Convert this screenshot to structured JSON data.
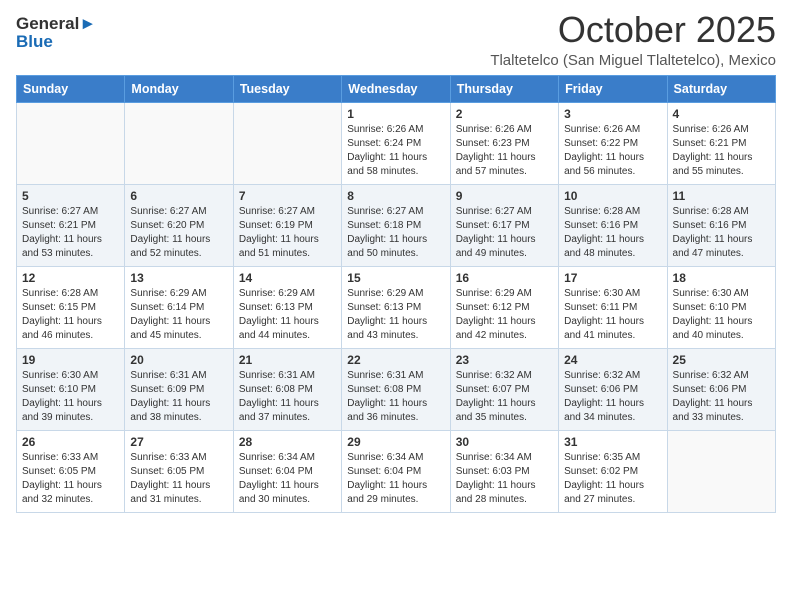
{
  "logo": {
    "line1": "General",
    "line2": "Blue"
  },
  "title": "October 2025",
  "location": "Tlaltetelco (San Miguel Tlaltetelco), Mexico",
  "days_of_week": [
    "Sunday",
    "Monday",
    "Tuesday",
    "Wednesday",
    "Thursday",
    "Friday",
    "Saturday"
  ],
  "weeks": [
    [
      {
        "day": "",
        "info": ""
      },
      {
        "day": "",
        "info": ""
      },
      {
        "day": "",
        "info": ""
      },
      {
        "day": "1",
        "info": "Sunrise: 6:26 AM\nSunset: 6:24 PM\nDaylight: 11 hours\nand 58 minutes."
      },
      {
        "day": "2",
        "info": "Sunrise: 6:26 AM\nSunset: 6:23 PM\nDaylight: 11 hours\nand 57 minutes."
      },
      {
        "day": "3",
        "info": "Sunrise: 6:26 AM\nSunset: 6:22 PM\nDaylight: 11 hours\nand 56 minutes."
      },
      {
        "day": "4",
        "info": "Sunrise: 6:26 AM\nSunset: 6:21 PM\nDaylight: 11 hours\nand 55 minutes."
      }
    ],
    [
      {
        "day": "5",
        "info": "Sunrise: 6:27 AM\nSunset: 6:21 PM\nDaylight: 11 hours\nand 53 minutes."
      },
      {
        "day": "6",
        "info": "Sunrise: 6:27 AM\nSunset: 6:20 PM\nDaylight: 11 hours\nand 52 minutes."
      },
      {
        "day": "7",
        "info": "Sunrise: 6:27 AM\nSunset: 6:19 PM\nDaylight: 11 hours\nand 51 minutes."
      },
      {
        "day": "8",
        "info": "Sunrise: 6:27 AM\nSunset: 6:18 PM\nDaylight: 11 hours\nand 50 minutes."
      },
      {
        "day": "9",
        "info": "Sunrise: 6:27 AM\nSunset: 6:17 PM\nDaylight: 11 hours\nand 49 minutes."
      },
      {
        "day": "10",
        "info": "Sunrise: 6:28 AM\nSunset: 6:16 PM\nDaylight: 11 hours\nand 48 minutes."
      },
      {
        "day": "11",
        "info": "Sunrise: 6:28 AM\nSunset: 6:16 PM\nDaylight: 11 hours\nand 47 minutes."
      }
    ],
    [
      {
        "day": "12",
        "info": "Sunrise: 6:28 AM\nSunset: 6:15 PM\nDaylight: 11 hours\nand 46 minutes."
      },
      {
        "day": "13",
        "info": "Sunrise: 6:29 AM\nSunset: 6:14 PM\nDaylight: 11 hours\nand 45 minutes."
      },
      {
        "day": "14",
        "info": "Sunrise: 6:29 AM\nSunset: 6:13 PM\nDaylight: 11 hours\nand 44 minutes."
      },
      {
        "day": "15",
        "info": "Sunrise: 6:29 AM\nSunset: 6:13 PM\nDaylight: 11 hours\nand 43 minutes."
      },
      {
        "day": "16",
        "info": "Sunrise: 6:29 AM\nSunset: 6:12 PM\nDaylight: 11 hours\nand 42 minutes."
      },
      {
        "day": "17",
        "info": "Sunrise: 6:30 AM\nSunset: 6:11 PM\nDaylight: 11 hours\nand 41 minutes."
      },
      {
        "day": "18",
        "info": "Sunrise: 6:30 AM\nSunset: 6:10 PM\nDaylight: 11 hours\nand 40 minutes."
      }
    ],
    [
      {
        "day": "19",
        "info": "Sunrise: 6:30 AM\nSunset: 6:10 PM\nDaylight: 11 hours\nand 39 minutes."
      },
      {
        "day": "20",
        "info": "Sunrise: 6:31 AM\nSunset: 6:09 PM\nDaylight: 11 hours\nand 38 minutes."
      },
      {
        "day": "21",
        "info": "Sunrise: 6:31 AM\nSunset: 6:08 PM\nDaylight: 11 hours\nand 37 minutes."
      },
      {
        "day": "22",
        "info": "Sunrise: 6:31 AM\nSunset: 6:08 PM\nDaylight: 11 hours\nand 36 minutes."
      },
      {
        "day": "23",
        "info": "Sunrise: 6:32 AM\nSunset: 6:07 PM\nDaylight: 11 hours\nand 35 minutes."
      },
      {
        "day": "24",
        "info": "Sunrise: 6:32 AM\nSunset: 6:06 PM\nDaylight: 11 hours\nand 34 minutes."
      },
      {
        "day": "25",
        "info": "Sunrise: 6:32 AM\nSunset: 6:06 PM\nDaylight: 11 hours\nand 33 minutes."
      }
    ],
    [
      {
        "day": "26",
        "info": "Sunrise: 6:33 AM\nSunset: 6:05 PM\nDaylight: 11 hours\nand 32 minutes."
      },
      {
        "day": "27",
        "info": "Sunrise: 6:33 AM\nSunset: 6:05 PM\nDaylight: 11 hours\nand 31 minutes."
      },
      {
        "day": "28",
        "info": "Sunrise: 6:34 AM\nSunset: 6:04 PM\nDaylight: 11 hours\nand 30 minutes."
      },
      {
        "day": "29",
        "info": "Sunrise: 6:34 AM\nSunset: 6:04 PM\nDaylight: 11 hours\nand 29 minutes."
      },
      {
        "day": "30",
        "info": "Sunrise: 6:34 AM\nSunset: 6:03 PM\nDaylight: 11 hours\nand 28 minutes."
      },
      {
        "day": "31",
        "info": "Sunrise: 6:35 AM\nSunset: 6:02 PM\nDaylight: 11 hours\nand 27 minutes."
      },
      {
        "day": "",
        "info": ""
      }
    ]
  ]
}
